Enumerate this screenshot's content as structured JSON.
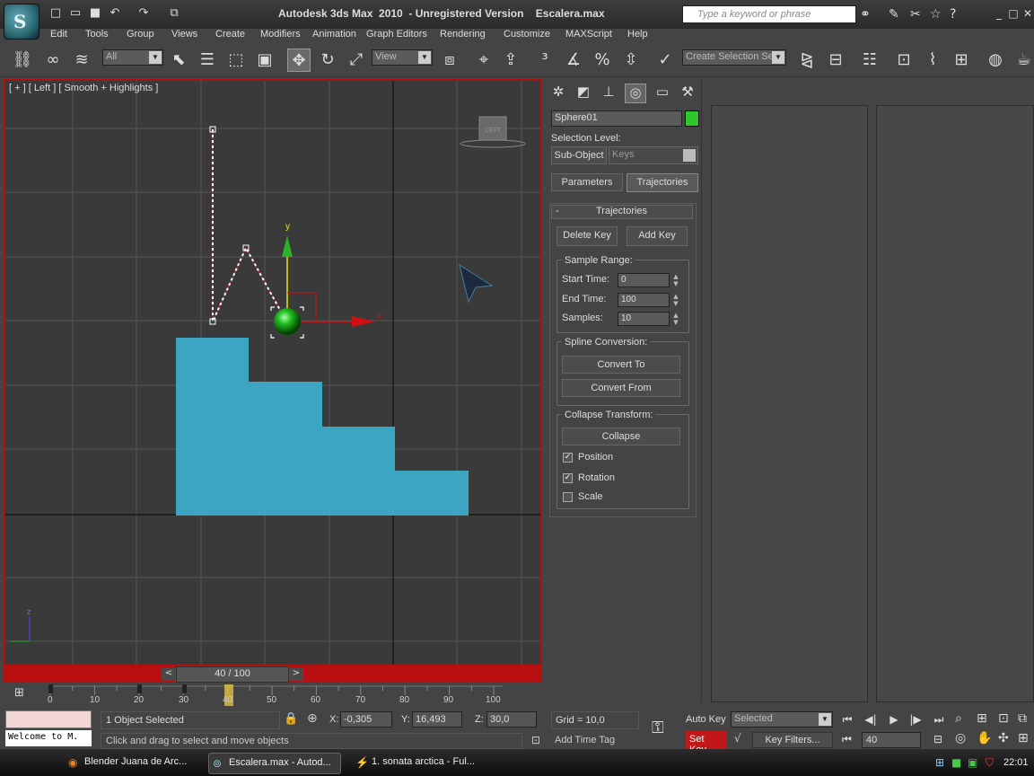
{
  "app": {
    "title": "Autodesk 3ds Max  2010  - Unregistered Version    Escalera.max",
    "search_placeholder": "Type a keyword or phrase"
  },
  "menu": [
    "Edit",
    "Tools",
    "Group",
    "Views",
    "Create",
    "Modifiers",
    "Animation",
    "Graph Editors",
    "Rendering",
    "Customize",
    "MAXScript",
    "Help"
  ],
  "toolbar": {
    "selection_filter": "All",
    "ref_coord": "View",
    "named_selection": "Create Selection Se"
  },
  "viewport": {
    "label": "[ + ] [ Left ] [ Smooth + Highlights ]",
    "viewcube_label": "LEFT",
    "axis_y": "y",
    "axis_x": "x",
    "axis_z": "z",
    "accent_color": "#b01010",
    "stair_color": "#3ba5c2"
  },
  "timeline": {
    "slider": "40 / 100",
    "ticks": [
      "0",
      "10",
      "20",
      "30",
      "40",
      "50",
      "60",
      "70",
      "80",
      "90",
      "100"
    ],
    "current_frame": 40
  },
  "status": {
    "selection": "1 Object Selected",
    "prompt": "Click and drag to select and move objects",
    "welcome": "Welcome to M.",
    "x_label": "X:",
    "x": "-0,305",
    "y_label": "Y:",
    "y": "16,493",
    "z_label": "Z:",
    "z": "30,0",
    "grid": "Grid = 10,0",
    "add_time_tag": "Add Time Tag"
  },
  "anim": {
    "auto_key": "Auto Key",
    "set_key": "Set Key",
    "selected": "Selected",
    "key_filters": "Key Filters...",
    "frame": "40"
  },
  "panel": {
    "object_name": "Sphere01",
    "object_color": "#2ec82e",
    "selection_level": "Selection Level:",
    "sub_object": "Sub-Object",
    "keys": "Keys",
    "tab_parameters": "Parameters",
    "tab_trajectories": "Trajectories",
    "rollout_collapse": "-",
    "rollout_title": "Trajectories",
    "delete_key": "Delete Key",
    "add_key": "Add Key",
    "sample_range": "Sample Range:",
    "start_time_label": "Start Time:",
    "start_time": "0",
    "end_time_label": "End Time:",
    "end_time": "100",
    "samples_label": "Samples:",
    "samples": "10",
    "spline_conversion": "Spline Conversion:",
    "convert_to": "Convert To",
    "convert_from": "Convert From",
    "collapse_transform": "Collapse Transform:",
    "collapse": "Collapse",
    "position": "Position",
    "rotation": "Rotation",
    "scale": "Scale"
  },
  "taskbar": {
    "items": [
      "Blender Juana de Arc...",
      "Escalera.max - Autod...",
      "1. sonata arctica - Ful..."
    ],
    "clock": "22:01"
  }
}
